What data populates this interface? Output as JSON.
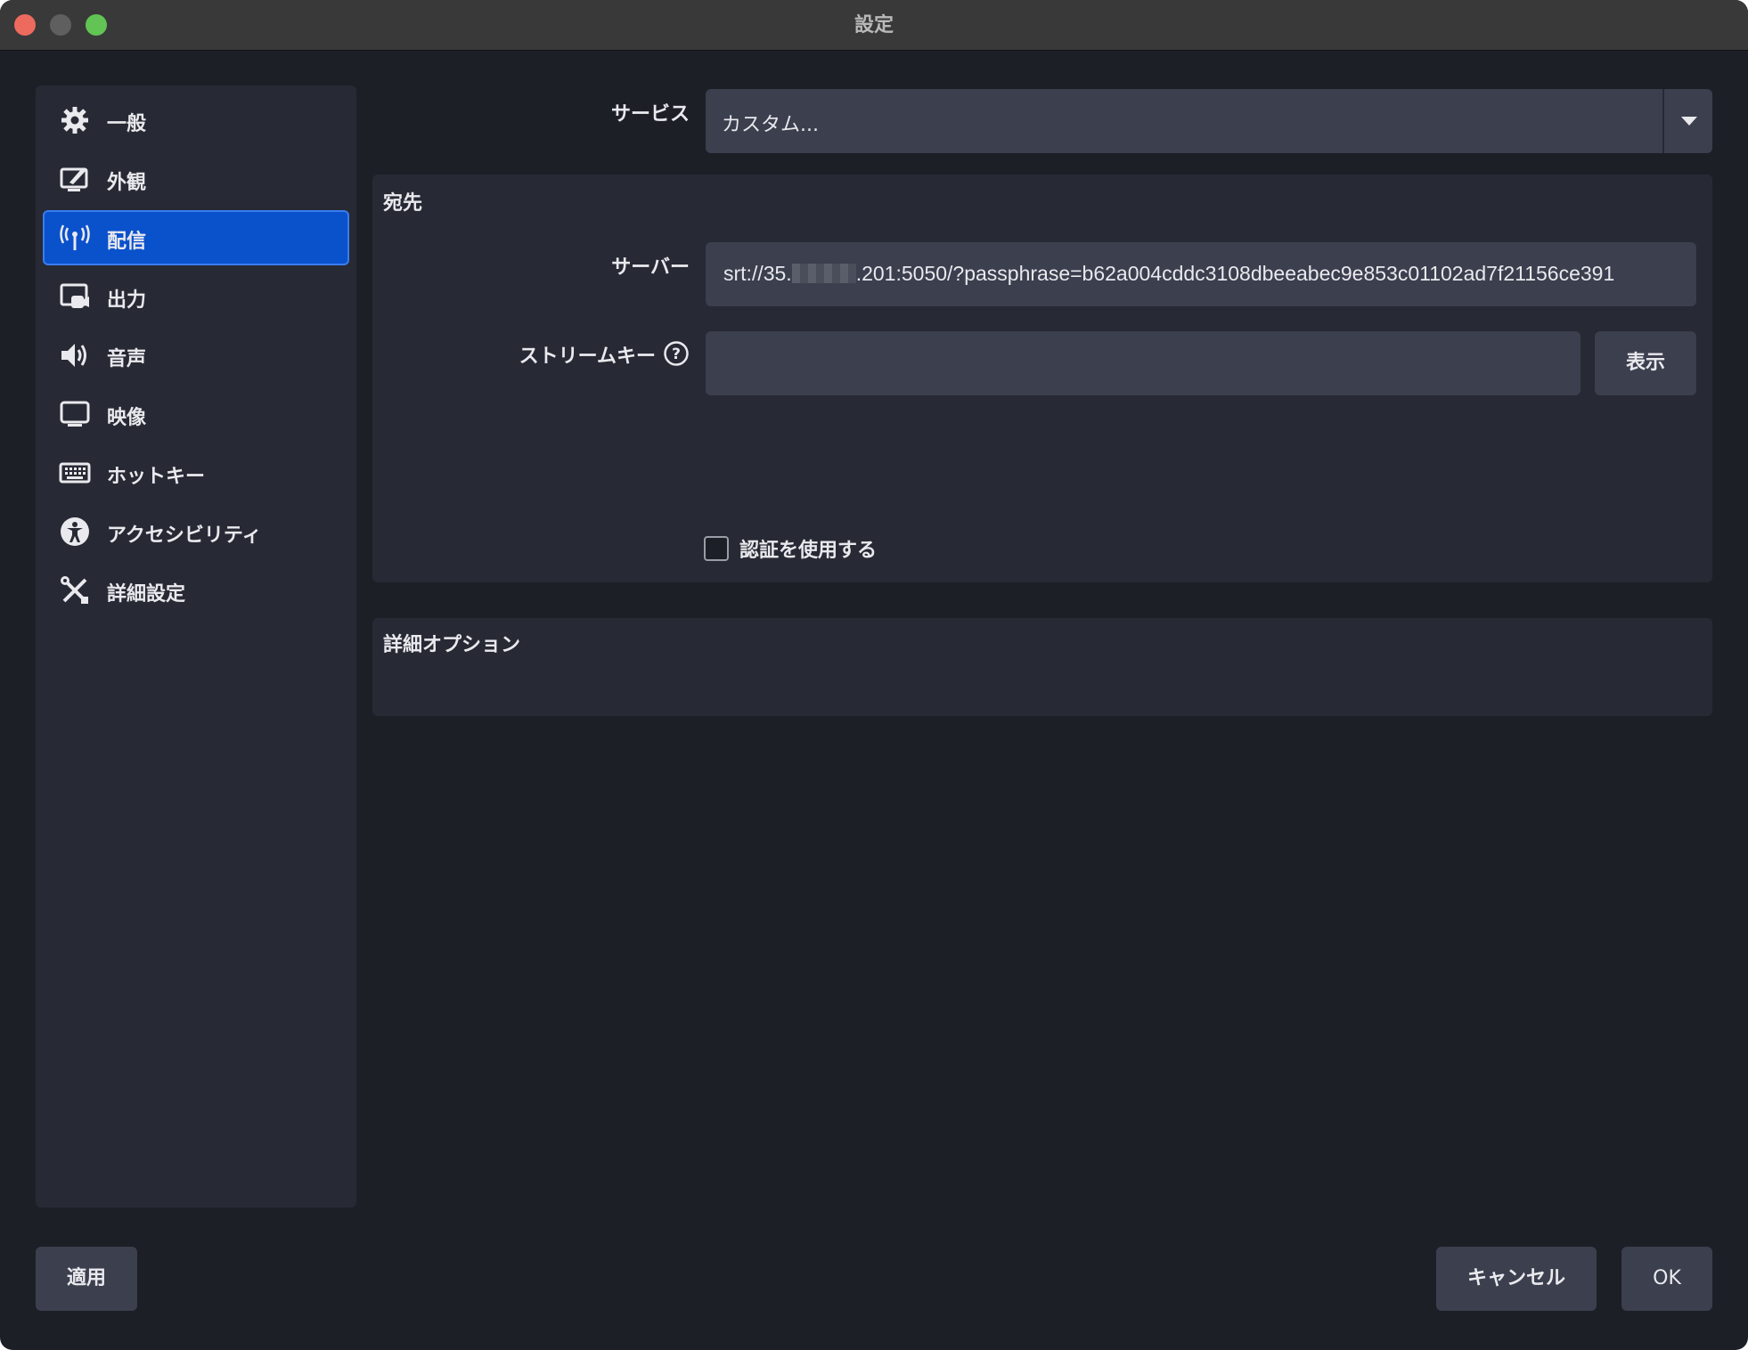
{
  "window": {
    "title": "設定"
  },
  "sidebar": {
    "items": [
      {
        "label": "一般",
        "icon": "gear-icon"
      },
      {
        "label": "外観",
        "icon": "appearance-icon"
      },
      {
        "label": "配信",
        "icon": "antenna-icon",
        "active": true
      },
      {
        "label": "出力",
        "icon": "output-icon"
      },
      {
        "label": "音声",
        "icon": "speaker-icon"
      },
      {
        "label": "映像",
        "icon": "monitor-icon"
      },
      {
        "label": "ホットキー",
        "icon": "keyboard-icon"
      },
      {
        "label": "アクセシビリティ",
        "icon": "accessibility-icon"
      },
      {
        "label": "詳細設定",
        "icon": "tools-icon"
      }
    ]
  },
  "stream": {
    "service_label": "サービス",
    "service_value": "カスタム...",
    "destination_title": "宛先",
    "server_label": "サーバー",
    "server_prefix": "srt://35.",
    "server_suffix": ".201:5050/?passphrase=b62a004cddc3108dbeeabec9e853c01102ad7f21156ce391",
    "stream_key_label": "ストリームキー",
    "stream_key_value": "",
    "show_button": "表示",
    "auth_checkbox_label": "認証を使用する",
    "auth_checked": false,
    "advanced_title": "詳細オプション"
  },
  "footer": {
    "apply": "適用",
    "cancel": "キャンセル",
    "ok": "OK"
  },
  "colors": {
    "accent": "#0a51cc",
    "background": "#1d1f27",
    "panel": "#272a34",
    "field": "#3b3f4e"
  }
}
